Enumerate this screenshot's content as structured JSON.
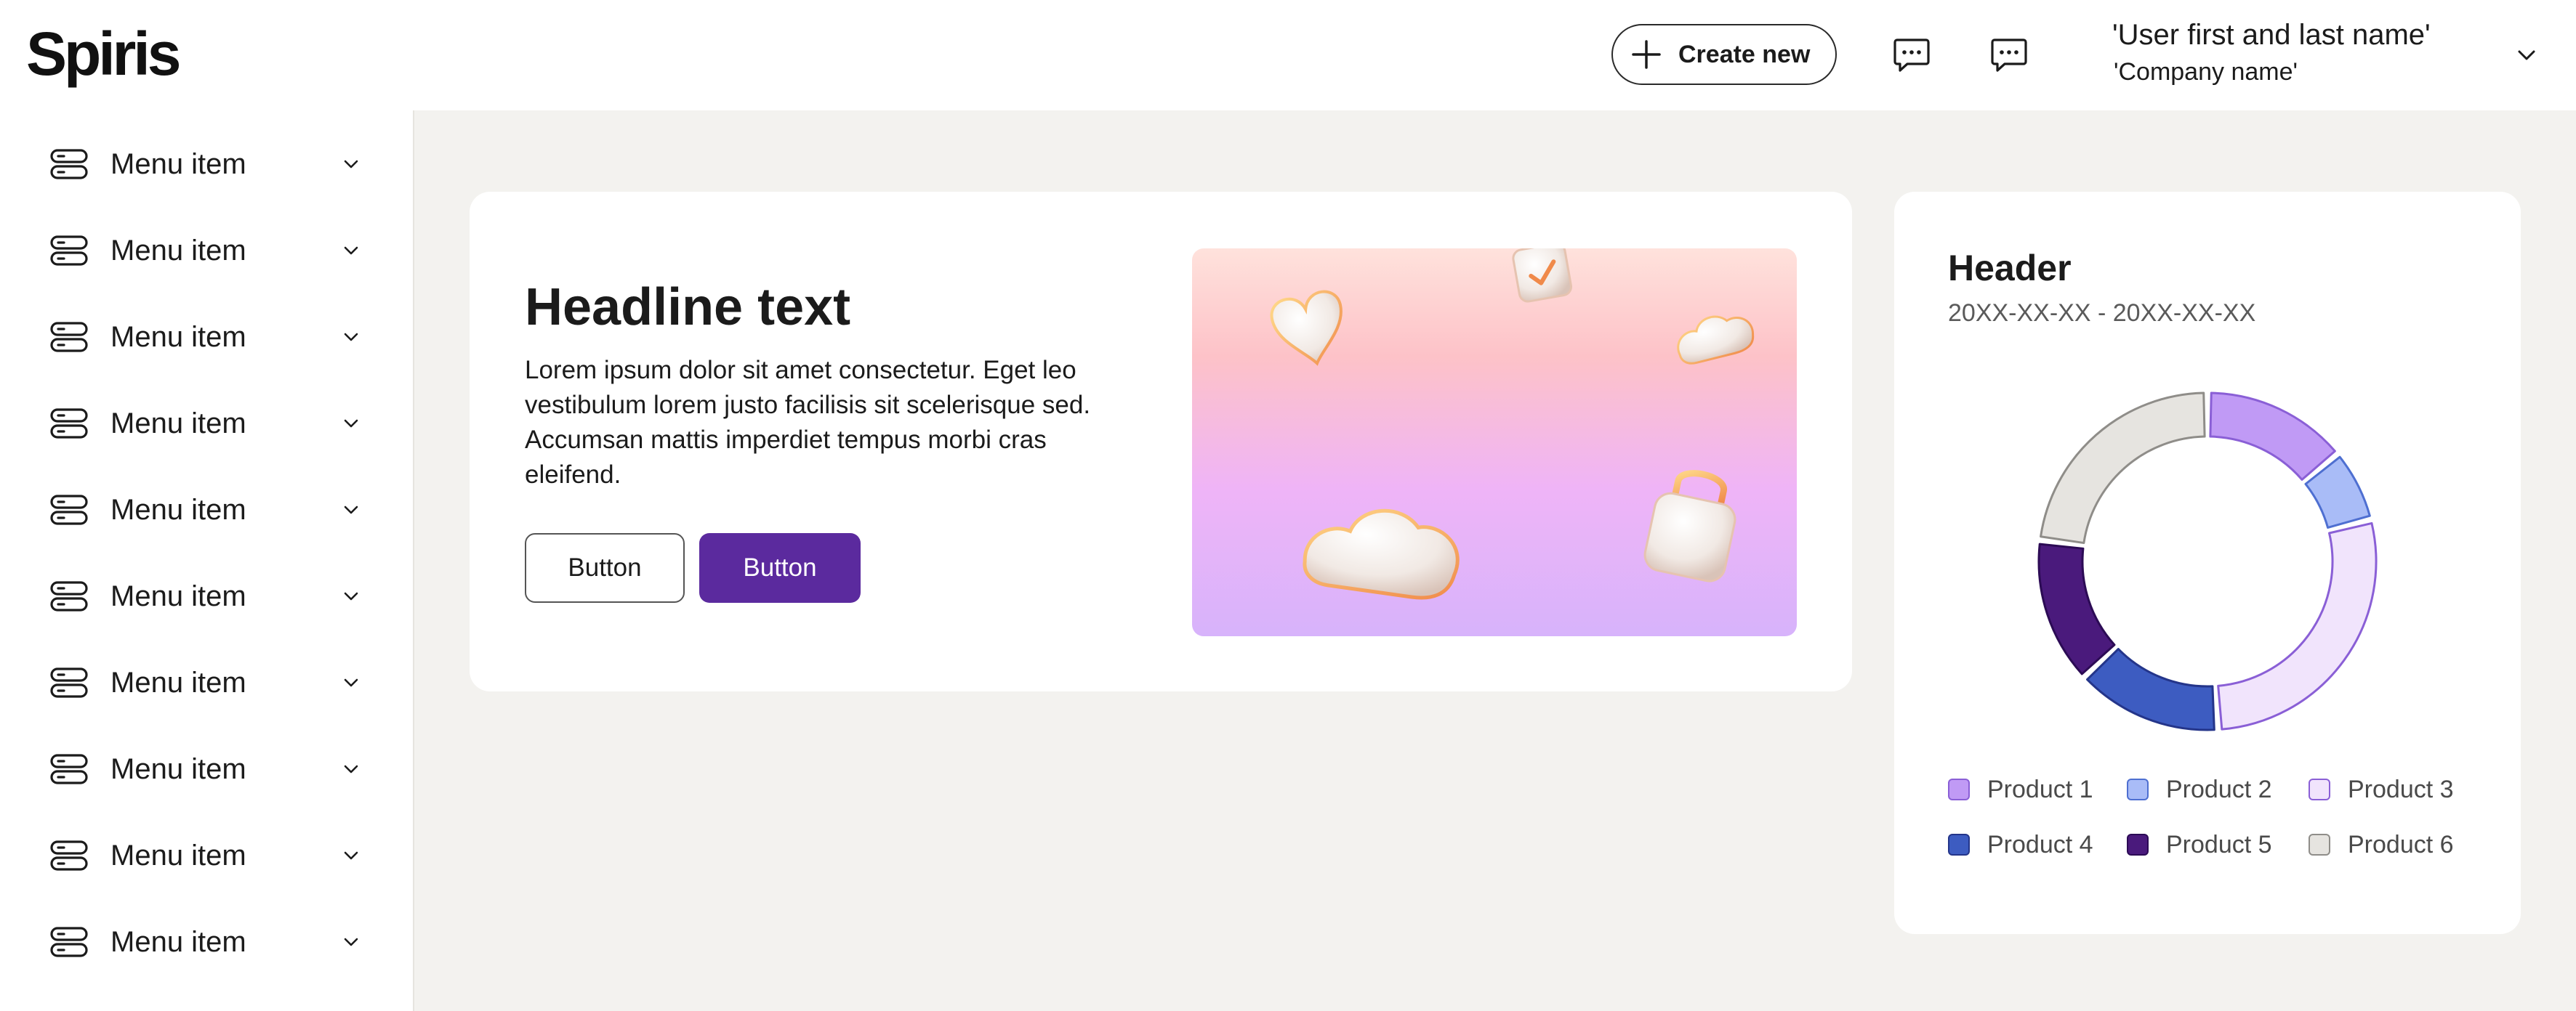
{
  "app": {
    "logo": "Spiris"
  },
  "header": {
    "create_label": "Create new",
    "create_icon": "plus-icon",
    "chat_icon": "chat-icon",
    "user_name": "'User first and last name'",
    "company_name": "'Company name'"
  },
  "sidebar": {
    "items": [
      {
        "label": "Menu item",
        "icon": "menu-stack-icon"
      },
      {
        "label": "Menu item",
        "icon": "menu-stack-icon"
      },
      {
        "label": "Menu item",
        "icon": "menu-stack-icon"
      },
      {
        "label": "Menu item",
        "icon": "menu-stack-icon"
      },
      {
        "label": "Menu item",
        "icon": "menu-stack-icon"
      },
      {
        "label": "Menu item",
        "icon": "menu-stack-icon"
      },
      {
        "label": "Menu item",
        "icon": "menu-stack-icon"
      },
      {
        "label": "Menu item",
        "icon": "menu-stack-icon"
      },
      {
        "label": "Menu item",
        "icon": "menu-stack-icon"
      },
      {
        "label": "Menu item",
        "icon": "menu-stack-icon"
      }
    ]
  },
  "hero": {
    "headline": "Headline text",
    "body": "Lorem ipsum dolor sit amet consectetur. Eget leo vestibulum lorem justo facilisis sit scelerisque sed. Accumsan mattis imperdiet tempus morbi cras eleifend.",
    "button_secondary": "Button",
    "button_primary": "Button",
    "primary_color": "#5b2a9e"
  },
  "chart_card": {
    "header": "Header",
    "date_range": "20XX-XX-XX - 20XX-XX-XX"
  },
  "chart_data": {
    "type": "pie",
    "variant": "donut",
    "title": "Header",
    "subtitle": "20XX-XX-XX - 20XX-XX-XX",
    "categories": [
      "Product 1",
      "Product 2",
      "Product 3",
      "Product 4",
      "Product 5",
      "Product 6"
    ],
    "values": [
      14,
      7,
      28,
      14,
      14,
      23
    ],
    "colors": [
      "#c09af5",
      "#a9bcf7",
      "#f1e4fc",
      "#3d5cc1",
      "#4a1a7c",
      "#e6e4e0"
    ],
    "legend_position": "bottom"
  }
}
